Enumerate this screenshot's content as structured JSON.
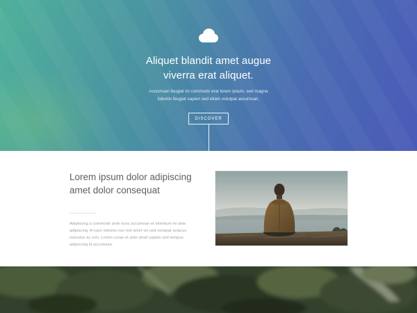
{
  "hero": {
    "icon": "cloud-icon",
    "title_lines": [
      "Aliquet blandit amet augue",
      "viverra erat aliquet."
    ],
    "subtitle_lines": [
      "Accumsan feugiat mi commodo erat lorem ipsum, sed magna",
      "lobortis feugiat sapien sed etiam volutpat accumsan."
    ],
    "button_label": "DISCOVER",
    "colors": {
      "gradient_start": "#4fb19a",
      "gradient_end": "#4a5ab8"
    }
  },
  "feature": {
    "heading_lines": [
      "Lorem ipsum dolor adipiscing",
      "amet dolor consequat"
    ],
    "body_lines": [
      "Adipiscing a commodo ante nunc accumsan et interdum mi ante",
      "adipiscing. A nunc lobortis non nisl amet vis sed volutpat aclacus",
      "nascetur ac non. Lorem curae et ante amet sapien sed tempus",
      "adipiscing id accumsan."
    ],
    "image": "man-sitting-on-cliff-photo"
  },
  "footer": {
    "image": "forest-mountain-photo"
  }
}
